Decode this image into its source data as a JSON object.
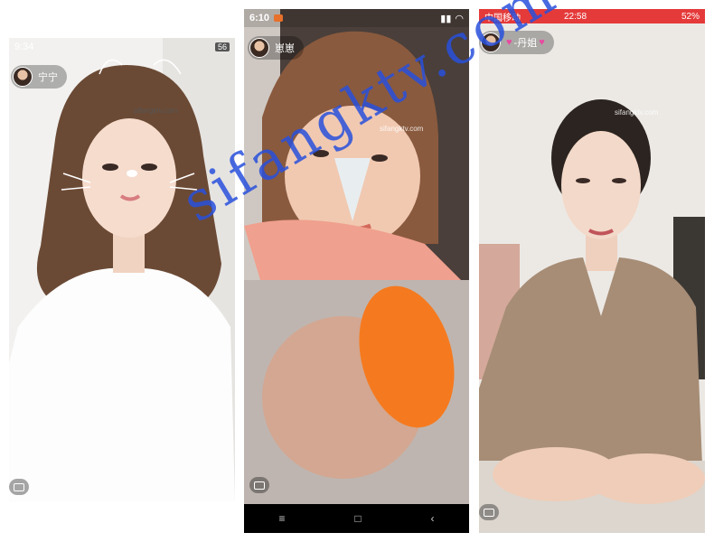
{
  "watermark": "sifangktv.com",
  "panels": [
    {
      "status_time": "9:34",
      "status_right": "56",
      "host_name": "宁宁",
      "photo_watermark": "sifangktv.com"
    },
    {
      "status_time": "6:10",
      "host_name": "崽崽",
      "photo_watermark": "sifangktv.com",
      "nav_keys": [
        "≡",
        "□",
        "‹"
      ]
    },
    {
      "carrier": "中国移动",
      "status_time": "22:58",
      "battery": "52%",
      "host_name": "-丹姐",
      "photo_watermark": "sifangktv.com"
    }
  ]
}
